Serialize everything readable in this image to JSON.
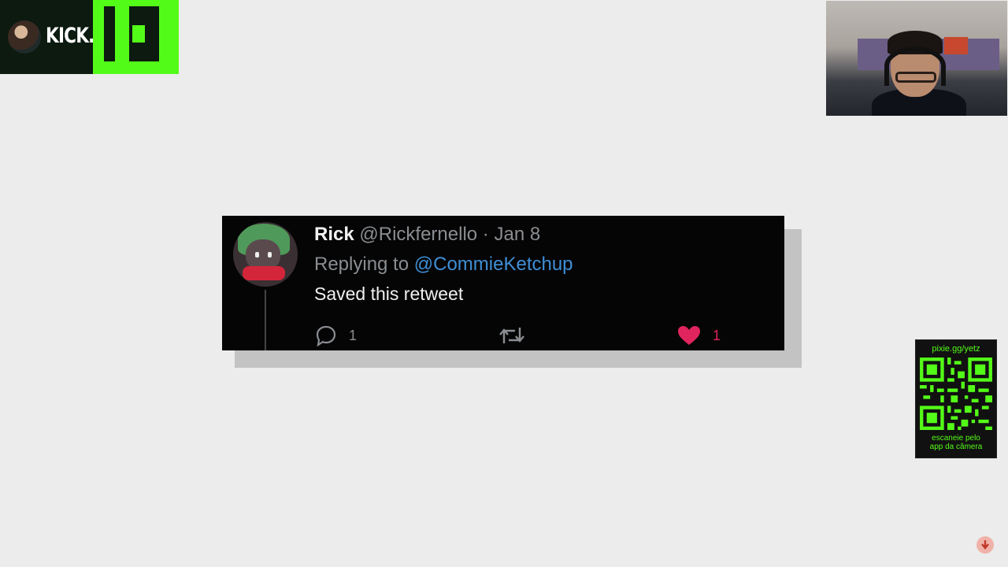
{
  "banner": {
    "text": "KICK.COM/YETZ",
    "brand_color": "#53fc18"
  },
  "tweet": {
    "name": "Rick",
    "handle": "@Rickfernello",
    "separator": "·",
    "date": "Jan 8",
    "replying_prefix": "Replying to",
    "replying_to": "@CommieKetchup",
    "text": "Saved this retweet",
    "reply_count": "1",
    "like_count": "1",
    "icons": [
      "reply-icon",
      "retweet-icon",
      "heart-icon"
    ],
    "colors": {
      "mention": "#3f8fd6",
      "like": "#e0245e"
    }
  },
  "qr": {
    "url": "pixie.gg/yetz",
    "caption_line1": "escaneie pelo",
    "caption_line2": "app da câmera"
  },
  "overlay": {
    "arrow_icon": "down-arrow-icon"
  }
}
